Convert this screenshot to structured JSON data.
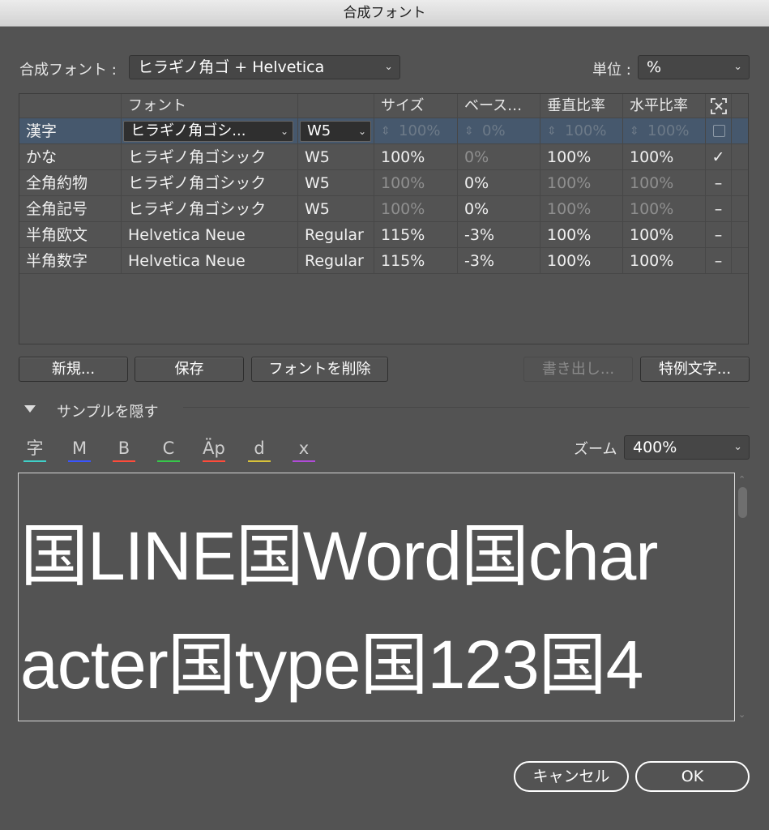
{
  "window": {
    "title": "合成フォント"
  },
  "top": {
    "composite_label": "合成フォント :",
    "composite_value": "ヒラギノ角ゴ + Helvetica",
    "unit_label": "単位 :",
    "unit_value": "%"
  },
  "table": {
    "headers": [
      "",
      "フォント",
      "",
      "サイズ",
      "ベース…",
      "垂直比率",
      "水平比率",
      "fit-icon"
    ],
    "rows": [
      {
        "name": "漢字",
        "font": "ヒラギノ角ゴシ...",
        "style": "W5",
        "size": "100%",
        "base": "0%",
        "vscale": "100%",
        "hscale": "100%",
        "mark": "checkbox"
      },
      {
        "name": "かな",
        "font": "ヒラギノ角ゴシック",
        "style": "W5",
        "size": "100%",
        "base": "0%",
        "vscale": "100%",
        "hscale": "100%",
        "mark": "✓"
      },
      {
        "name": "全角約物",
        "font": "ヒラギノ角ゴシック",
        "style": "W5",
        "size": "100%",
        "base": "0%",
        "vscale": "100%",
        "hscale": "100%",
        "mark": "–"
      },
      {
        "name": "全角記号",
        "font": "ヒラギノ角ゴシック",
        "style": "W5",
        "size": "100%",
        "base": "0%",
        "vscale": "100%",
        "hscale": "100%",
        "mark": "–"
      },
      {
        "name": "半角欧文",
        "font": "Helvetica Neue",
        "style": "Regular",
        "size": "115%",
        "base": "-3%",
        "vscale": "100%",
        "hscale": "100%",
        "mark": "–"
      },
      {
        "name": "半角数字",
        "font": "Helvetica Neue",
        "style": "Regular",
        "size": "115%",
        "base": "-3%",
        "vscale": "100%",
        "hscale": "100%",
        "mark": "–"
      }
    ]
  },
  "buttons": {
    "new": "新規...",
    "save": "保存",
    "delete_font": "フォントを削除",
    "export": "書き出し...",
    "exceptions": "特例文字..."
  },
  "sample_section": {
    "toggle_label": "サンプルを隠す",
    "zoom_label": "ズーム",
    "zoom_value": "400%",
    "guide_icons": [
      {
        "glyph": "字",
        "name": "em-box-icon",
        "color": "#3fd0c8"
      },
      {
        "glyph": "M",
        "name": "cap-height-icon",
        "color": "#3a55ff"
      },
      {
        "glyph": "B",
        "name": "baseline-icon",
        "color": "#ff4b3a"
      },
      {
        "glyph": "C",
        "name": "x-height-center-icon",
        "color": "#36c84a"
      },
      {
        "glyph": "Äp",
        "name": "ascent-descent-icon",
        "color": "#ff4b3a"
      },
      {
        "glyph": "d",
        "name": "ideographic-box-icon",
        "color": "#d8c23a"
      },
      {
        "glyph": "x",
        "name": "x-height-icon",
        "color": "#b04bd8"
      }
    ],
    "sample_text_line1": "国LINE国Word国char",
    "sample_text_line2": "acter国type国123国4"
  },
  "footer": {
    "cancel": "キャンセル",
    "ok": "OK"
  }
}
